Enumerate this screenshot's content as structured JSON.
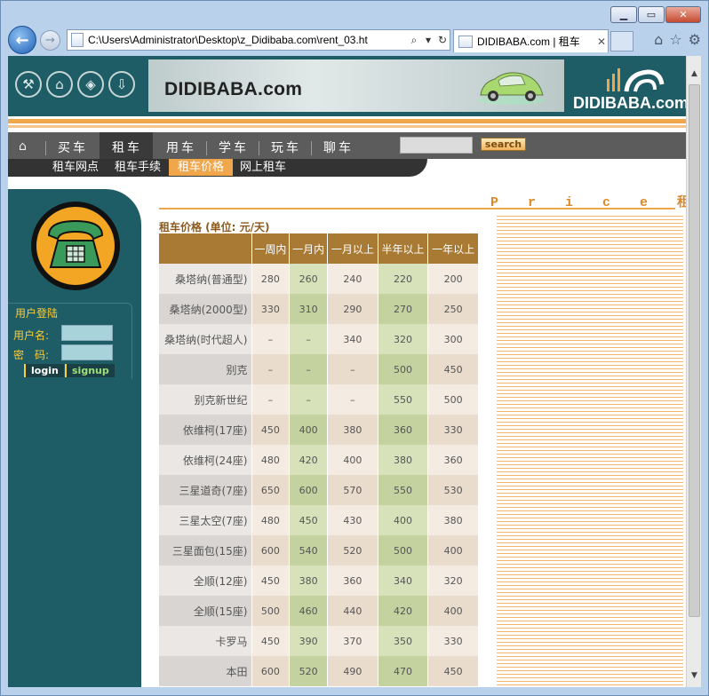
{
  "browser": {
    "address": "C:\\Users\\Administrator\\Desktop\\z_Didibaba.com\\rent_03.ht",
    "tab_title": "DIDIBABA.com | 租车",
    "tab_close": "✕",
    "icons": [
      "back-icon",
      "forward-icon",
      "home-icon",
      "star-icon",
      "gear-icon"
    ]
  },
  "site": {
    "banner_text": "DIDIBABA.com",
    "logo_text": "DIDIBABA.com",
    "nav": [
      "买车",
      "租车",
      "用车",
      "学车",
      "玩车",
      "聊车"
    ],
    "search_label": "search",
    "subnav": [
      "租车网点",
      "租车手续",
      "租车价格",
      "网上租车"
    ]
  },
  "login": {
    "title": "用户登陆",
    "username_label": "用户名:",
    "password_label": "密　码:",
    "login_label": "login",
    "signup_label": "signup"
  },
  "page": {
    "title_en": "P r i c e",
    "title_cn": "租 车 价 格",
    "caption": "租车价格 (单位: 元/天)"
  },
  "table": {
    "headers": [
      "",
      "一周内",
      "一月内",
      "一月以上",
      "半年以上",
      "一年以上"
    ],
    "rows": [
      {
        "name": "桑塔纳(普通型)",
        "v": [
          "280",
          "260",
          "240",
          "220",
          "200"
        ]
      },
      {
        "name": "桑塔纳(2000型)",
        "v": [
          "330",
          "310",
          "290",
          "270",
          "250"
        ]
      },
      {
        "name": "桑塔纳(时代超人)",
        "v": [
          "–",
          "–",
          "340",
          "320",
          "300"
        ]
      },
      {
        "name": "别克",
        "v": [
          "–",
          "–",
          "–",
          "500",
          "450"
        ]
      },
      {
        "name": "别克新世纪",
        "v": [
          "–",
          "–",
          "–",
          "550",
          "500"
        ]
      },
      {
        "name": "依维柯(17座)",
        "v": [
          "450",
          "400",
          "380",
          "360",
          "330"
        ]
      },
      {
        "name": "依维柯(24座)",
        "v": [
          "480",
          "420",
          "400",
          "380",
          "360"
        ]
      },
      {
        "name": "三星道奇(7座)",
        "v": [
          "650",
          "600",
          "570",
          "550",
          "530"
        ]
      },
      {
        "name": "三星太空(7座)",
        "v": [
          "480",
          "450",
          "430",
          "400",
          "380"
        ]
      },
      {
        "name": "三星面包(15座)",
        "v": [
          "600",
          "540",
          "520",
          "500",
          "400"
        ]
      },
      {
        "name": "全顺(12座)",
        "v": [
          "450",
          "380",
          "360",
          "340",
          "320"
        ]
      },
      {
        "name": "全顺(15座)",
        "v": [
          "500",
          "460",
          "440",
          "420",
          "400"
        ]
      },
      {
        "name": "卡罗马",
        "v": [
          "450",
          "390",
          "370",
          "350",
          "330"
        ]
      },
      {
        "name": "本田",
        "v": [
          "600",
          "520",
          "490",
          "470",
          "450"
        ]
      }
    ]
  }
}
